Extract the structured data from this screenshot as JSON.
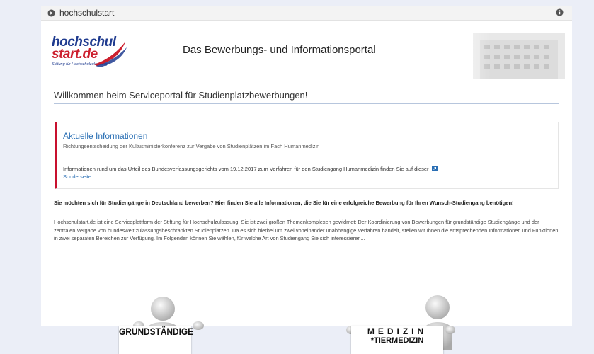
{
  "topbar": {
    "brand": "hochschulstart"
  },
  "header": {
    "logo_line1": "hochschul",
    "logo_line2": "start.de",
    "logo_sub": "Stiftung für Hochschulzulassung",
    "portal_title": "Das Bewerbungs- und Informationsportal"
  },
  "welcome": "Willkommen beim Serviceportal für Studienplatzbewerbungen!",
  "info": {
    "heading": "Aktuelle Informationen",
    "subheading": "Richtungsentscheidung der Kultusministerkonferenz zur Vergabe von Studienplätzen im Fach Humanmedizin",
    "text": "Informationen rund um das Urteil des Bundesverfassungsgerichts vom 19.12.2017 zum Verfahren für den Studiengang Humanmedizin finden Sie auf dieser",
    "link_label": "Sonderseite."
  },
  "question": "Sie möchten sich für Studiengänge in Deutschland bewerben? Hier finden Sie alle Informationen, die Sie für eine erfolgreiche Bewerbung für Ihren Wunsch-Studiengang benötigen!",
  "description": "Hochschulstart.de ist eine Serviceplattform der Stiftung für Hochschulzulassung. Sie ist zwei großen Themenkomplexen gewidmet: Der Koordinierung von Bewerbungen für grundständige Studiengänge und der zentralen Vergabe von bundesweit zulassungsbeschränkten Studienplätzen. Da es sich hierbei um zwei voneinander unabhängige Verfahren handelt, stellen wir Ihnen die entsprechenden Informationen und Funktionen in zwei separaten Bereichen zur Verfügung. Im Folgenden können Sie wählen, für welche Art von Studiengang Sie sich interessieren...",
  "cards": {
    "left_sign": "GRUNDSTÄNDIGE",
    "right_sign_line1": "MEDIZIN",
    "right_sign_line2": "*TIERMEDIZIN"
  },
  "colors": {
    "accent": "#c8102e",
    "link": "#2a6fb4",
    "background": "#ebeef7"
  },
  "icons": [
    "play-icon",
    "info-icon",
    "external-link-icon",
    "wave-logo-icon",
    "building-illustration"
  ]
}
